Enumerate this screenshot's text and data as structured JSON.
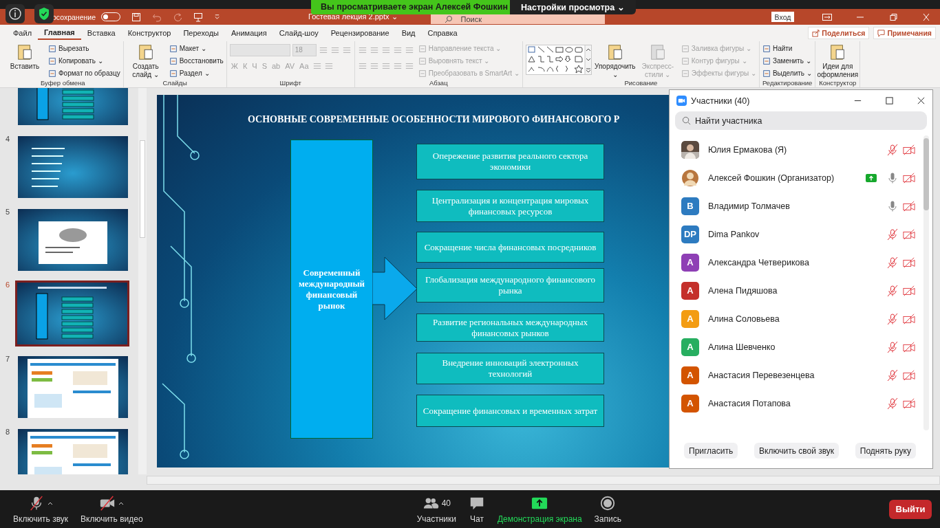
{
  "overlay": {
    "banner": "Вы просматриваете экран Алексей Фошкин",
    "view_options": "Настройки просмотра ⌄"
  },
  "titlebar": {
    "autosave_label": "осохранение",
    "autosave_on": false,
    "document": "Гостевая лекция 2.pptx ⌄",
    "search": {
      "placeholder": "Поиск"
    },
    "signin": "Вход"
  },
  "tabs": [
    {
      "label": "Файл",
      "selected": false
    },
    {
      "label": "Главная",
      "selected": true
    },
    {
      "label": "Вставка",
      "selected": false
    },
    {
      "label": "Конструктор",
      "selected": false
    },
    {
      "label": "Переходы",
      "selected": false
    },
    {
      "label": "Анимация",
      "selected": false
    },
    {
      "label": "Слайд-шоу",
      "selected": false
    },
    {
      "label": "Рецензирование",
      "selected": false
    },
    {
      "label": "Вид",
      "selected": false
    },
    {
      "label": "Справка",
      "selected": false
    }
  ],
  "share_buttons": [
    "Поделиться",
    "Примечания"
  ],
  "ribbon": {
    "groups": [
      {
        "label": "Буфер обмена",
        "columns": [
          {
            "items": [
              {
                "kind": "large",
                "label": "Вставить",
                "disabled": false
              }
            ]
          },
          {
            "items": [
              {
                "kind": "small",
                "label": "Вырезать",
                "disabled": false
              },
              {
                "kind": "small",
                "label": "Копировать ⌄",
                "disabled": false
              },
              {
                "kind": "small",
                "label": "Формат по образцу",
                "disabled": false
              }
            ]
          }
        ]
      },
      {
        "label": "Слайды",
        "columns": [
          {
            "items": [
              {
                "kind": "large",
                "label": "Создать слайд ⌄",
                "disabled": false
              }
            ]
          },
          {
            "items": [
              {
                "kind": "small",
                "label": "Макет ⌄",
                "disabled": false
              },
              {
                "kind": "small",
                "label": "Восстановить",
                "disabled": false
              },
              {
                "kind": "small",
                "label": "Раздел ⌄",
                "disabled": false
              }
            ]
          }
        ]
      },
      {
        "label": "Шрифт",
        "columns": [
          {
            "items": [
              {
                "kind": "row",
                "items": [
                  {
                    "kind": "field",
                    "disabled": true
                  },
                  {
                    "kind": "size",
                    "value": "18",
                    "disabled": true
                  },
                  {
                    "kind": "icon",
                    "disabled": true
                  },
                  {
                    "kind": "icon",
                    "disabled": true
                  },
                  {
                    "kind": "icon",
                    "disabled": true
                  }
                ]
              },
              {
                "kind": "row",
                "items": [
                  {
                    "kind": "glyph",
                    "label": "Ж",
                    "disabled": true
                  },
                  {
                    "kind": "glyph",
                    "label": "К",
                    "disabled": true
                  },
                  {
                    "kind": "glyph",
                    "label": "Ч",
                    "disabled": true
                  },
                  {
                    "kind": "glyph",
                    "label": "S",
                    "disabled": true
                  },
                  {
                    "kind": "glyph",
                    "label": "ab",
                    "disabled": true
                  },
                  {
                    "kind": "glyph",
                    "label": "AV",
                    "disabled": true
                  },
                  {
                    "kind": "glyph",
                    "label": "Aa",
                    "disabled": true
                  },
                  {
                    "kind": "icon",
                    "disabled": true
                  },
                  {
                    "kind": "icon",
                    "disabled": true
                  }
                ]
              }
            ]
          }
        ]
      },
      {
        "label": "Абзац",
        "columns": [
          {
            "items": [
              {
                "kind": "row",
                "items": [
                  {
                    "kind": "icon",
                    "disabled": true
                  },
                  {
                    "kind": "icon",
                    "disabled": true
                  },
                  {
                    "kind": "icon",
                    "disabled": true
                  },
                  {
                    "kind": "icon",
                    "disabled": true
                  },
                  {
                    "kind": "icon",
                    "disabled": true
                  }
                ]
              },
              {
                "kind": "row",
                "items": [
                  {
                    "kind": "icon",
                    "disabled": true
                  },
                  {
                    "kind": "icon",
                    "disabled": true
                  },
                  {
                    "kind": "icon",
                    "disabled": true
                  },
                  {
                    "kind": "icon",
                    "disabled": true
                  },
                  {
                    "kind": "icon",
                    "disabled": true
                  }
                ]
              }
            ]
          },
          {
            "items": [
              {
                "kind": "small",
                "label": "Направление текста ⌄",
                "disabled": true
              },
              {
                "kind": "small",
                "label": "Выровнять текст ⌄",
                "disabled": true
              },
              {
                "kind": "small",
                "label": "Преобразовать в SmartArt ⌄",
                "disabled": true
              }
            ]
          }
        ]
      },
      {
        "label": "Рисование",
        "columns": [
          {
            "items": [
              {
                "kind": "gallery",
                "disabled": false
              }
            ]
          },
          {
            "items": [
              {
                "kind": "large",
                "label": "Упорядочить ⌄",
                "disabled": false
              }
            ]
          },
          {
            "items": [
              {
                "kind": "large",
                "label": "Экспресс-стили ⌄",
                "disabled": true
              }
            ]
          },
          {
            "items": [
              {
                "kind": "small",
                "label": "Заливка фигуры ⌄",
                "disabled": true
              },
              {
                "kind": "small",
                "label": "Контур фигуры ⌄",
                "disabled": true
              },
              {
                "kind": "small",
                "label": "Эффекты фигуры ⌄",
                "disabled": true
              }
            ]
          }
        ]
      },
      {
        "label": "Редактирование",
        "columns": [
          {
            "items": [
              {
                "kind": "small",
                "label": "Найти",
                "disabled": false
              },
              {
                "kind": "small",
                "label": "Заменить ⌄",
                "disabled": false
              },
              {
                "kind": "small",
                "label": "Выделить ⌄",
                "disabled": false
              }
            ]
          }
        ]
      },
      {
        "label": "Конструктор",
        "columns": [
          {
            "items": [
              {
                "kind": "large",
                "label": "Идеи для оформления",
                "disabled": false
              }
            ]
          }
        ]
      }
    ]
  },
  "thumbnails": [
    {
      "kind": "diagram",
      "selected": false
    },
    {
      "number": "4",
      "kind": "list",
      "selected": false
    },
    {
      "number": "5",
      "kind": "chart",
      "selected": false
    },
    {
      "number": "6",
      "kind": "diagram",
      "selected": true
    },
    {
      "number": "7",
      "kind": "infographic",
      "selected": false
    },
    {
      "number": "8",
      "kind": "infographic",
      "selected": false
    }
  ],
  "slide": {
    "title": "ОСНОВНЫЕ СОВРЕМЕННЫЕ ОСОБЕННОСТИ МИРОВОГО ФИНАНСОВОГО Р",
    "center": "Современный международный финансовый рынок",
    "boxes": [
      "Опережение развития реального сектора экономики",
      "Централизация и концентрация мировых финансовых ресурсов",
      "Сокращение числа финансовых посредников",
      "Глобализация международного финансового рынка",
      "Развитие региональных международных финансовых рынков",
      "Внедрение инноваций электронных технологий",
      "Сокращение финансовых и временных затрат"
    ]
  },
  "participants_panel": {
    "title": "Участники (40)",
    "search": {
      "placeholder": "Найти участника"
    },
    "participants": [
      {
        "name": "Юлия Ермакова (Я)",
        "sharing": false,
        "mic_muted": true
      },
      {
        "name": "Алексей Фошкин (Организатор)",
        "sharing": true,
        "mic_muted": false
      },
      {
        "name": "Владимир Толмачев",
        "kind": "initials",
        "initials": "В",
        "color": "#2d7bc0",
        "sharing": false,
        "mic_muted": false
      },
      {
        "name": "Dima Pankov",
        "kind": "initials",
        "initials": "DP",
        "color": "#2d7bc0",
        "sharing": false,
        "mic_muted": true
      },
      {
        "name": "Александра Четверикова",
        "kind": "initials",
        "initials": "А",
        "color": "#8e3fb5",
        "sharing": false,
        "mic_muted": true
      },
      {
        "name": "Алена Пидяшова",
        "kind": "initials",
        "initials": "А",
        "color": "#c4302b",
        "sharing": false,
        "mic_muted": true
      },
      {
        "name": "Алина Соловьева",
        "kind": "initials",
        "initials": "А",
        "color": "#f39c12",
        "sharing": false,
        "mic_muted": true
      },
      {
        "name": "Алина Шевченко",
        "kind": "initials",
        "initials": "А",
        "color": "#27ae60",
        "sharing": false,
        "mic_muted": true
      },
      {
        "name": "Анастасия Перевезенцева",
        "kind": "initials",
        "initials": "А",
        "color": "#d35400",
        "sharing": false,
        "mic_muted": true
      },
      {
        "name": "Анастасия Потапова",
        "kind": "initials",
        "initials": "А",
        "color": "#d35400",
        "sharing": false,
        "mic_muted": true
      }
    ],
    "buttons": [
      "Пригласить",
      "Включить свой звук",
      "Поднять руку"
    ]
  },
  "toolbar": {
    "left": [
      {
        "kind": "mic",
        "label": "Включить звук"
      },
      {
        "kind": "video",
        "label": "Включить видео"
      }
    ],
    "center": [
      {
        "kind": "participants",
        "label": "Участники",
        "count": "40",
        "highlighted": false
      },
      {
        "kind": "chat",
        "label": "Чат",
        "highlighted": false
      },
      {
        "kind": "share",
        "label": "Демонстрация экрана",
        "highlighted": true
      },
      {
        "kind": "record",
        "label": "Запись",
        "highlighted": false
      }
    ],
    "leave": "Выйти"
  }
}
